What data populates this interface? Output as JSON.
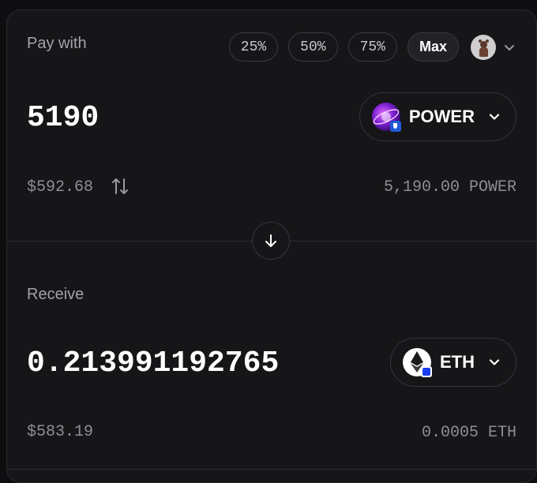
{
  "pay": {
    "label": "Pay with",
    "percent_buttons": [
      "25%",
      "50%",
      "75%",
      "Max"
    ],
    "amount": "5190",
    "usd_value": "$592.68",
    "balance": "5,190.00 POWER",
    "token": {
      "symbol": "POWER",
      "icon": "power-token-icon",
      "badge_color": "#1f5bd6"
    }
  },
  "receive": {
    "label": "Receive",
    "amount": "0.213991192765",
    "usd_value": "$583.19",
    "balance": "0.0005 ETH",
    "token": {
      "symbol": "ETH",
      "icon": "eth-token-icon",
      "badge_color": "#1a3ef0"
    }
  },
  "colors": {
    "background": "#161618",
    "border": "#2a2a2e",
    "muted_text": "#8e8e94"
  }
}
